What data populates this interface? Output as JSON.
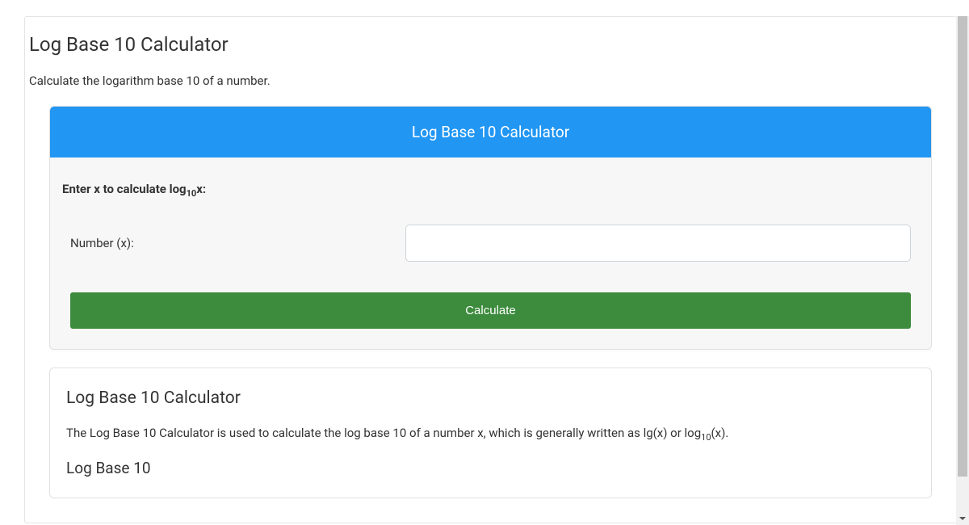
{
  "page": {
    "title": "Log Base 10 Calculator",
    "subtitle": "Calculate the logarithm base 10 of a number."
  },
  "calculator": {
    "header": "Log Base 10 Calculator",
    "prompt_prefix": "Enter x to calculate log",
    "prompt_sub": "10",
    "prompt_suffix": "x:",
    "input_label": "Number (x):",
    "input_value": "",
    "button_label": "Calculate"
  },
  "info": {
    "heading": "Log Base 10 Calculator",
    "text_prefix": "The Log Base 10 Calculator is used to calculate the log base 10 of a number x, which is generally written as lg(x) or log",
    "text_sub": "10",
    "text_suffix": "(x).",
    "subheading": "Log Base 10"
  }
}
